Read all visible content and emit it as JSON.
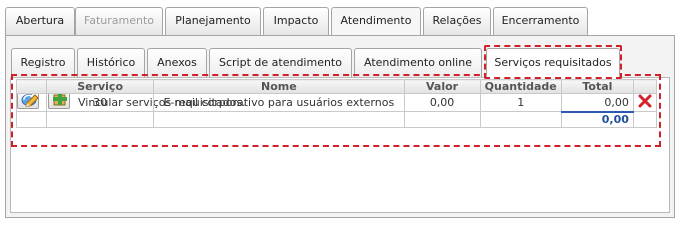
{
  "top_tabs": [
    {
      "label": "Abertura"
    },
    {
      "label": "Faturamento"
    },
    {
      "label": "Planejamento"
    },
    {
      "label": "Impacto"
    },
    {
      "label": "Atendimento"
    },
    {
      "label": "Relações"
    },
    {
      "label": "Encerramento"
    }
  ],
  "sub_tabs": [
    {
      "label": "Registro"
    },
    {
      "label": "Histórico"
    },
    {
      "label": "Anexos"
    },
    {
      "label": "Script de atendimento"
    },
    {
      "label": "Atendimento online"
    },
    {
      "label": "Serviços requisitados"
    }
  ],
  "toolbar": {
    "link_label": "Vincular serviços requisitados.",
    "refresh_icon": "refresh-icon",
    "add_icon": "add-icon"
  },
  "grid": {
    "headers": [
      "Serviço",
      "Nome",
      "Valor",
      "Quantidade",
      "Total"
    ],
    "rows": [
      {
        "servico": "30",
        "nome": "E-mail corporativo para usuários externos",
        "valor": "0,00",
        "quantidade": "1",
        "total": "0,00"
      }
    ],
    "grand_total": "0,00"
  },
  "colors": {
    "highlight": "#d0212b",
    "total_text": "#1f4e9a"
  }
}
